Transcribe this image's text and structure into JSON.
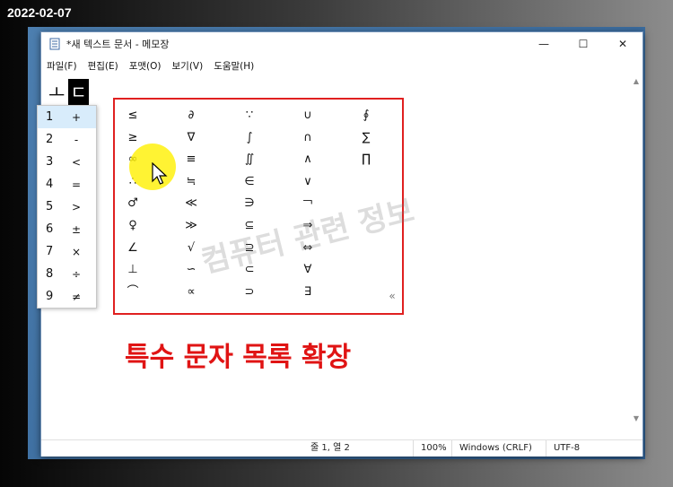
{
  "date_stamp": "2022-02-07",
  "window": {
    "title": "*새 텍스트 문서 - 메모장",
    "controls": {
      "minimize": "—",
      "maximize": "☐",
      "close": "✕"
    }
  },
  "menu": [
    "파일(F)",
    "편집(E)",
    "포맷(O)",
    "보기(V)",
    "도움말(H)"
  ],
  "editor": {
    "text": "ㅗ",
    "selected": "ㄷ"
  },
  "candidates": [
    {
      "num": "1",
      "sym": "+"
    },
    {
      "num": "2",
      "sym": "-"
    },
    {
      "num": "3",
      "sym": "<"
    },
    {
      "num": "4",
      "sym": "="
    },
    {
      "num": "5",
      "sym": ">"
    },
    {
      "num": "6",
      "sym": "±"
    },
    {
      "num": "7",
      "sym": "×"
    },
    {
      "num": "8",
      "sym": "÷"
    },
    {
      "num": "9",
      "sym": "≠"
    }
  ],
  "expanded_columns": [
    [
      "≤",
      "≥",
      "∞",
      "∴",
      "♂",
      "♀",
      "∠",
      "⊥",
      "⌒"
    ],
    [
      "∂",
      "∇",
      "≡",
      "≒",
      "≪",
      "≫",
      "√",
      "∽",
      "∝"
    ],
    [
      "∵",
      "∫",
      "∬",
      "∈",
      "∋",
      "⊆",
      "⊇",
      "⊂",
      "⊃"
    ],
    [
      "∪",
      "∩",
      "∧",
      "∨",
      "￢",
      "⇒",
      "⇔",
      "∀",
      "∃"
    ],
    [
      "∮",
      "∑",
      "∏",
      "",
      "",
      "",
      "",
      "",
      ""
    ]
  ],
  "collapse_glyph": "«",
  "watermark": "컴퓨터 관련 정보",
  "annotation": "특수 문자 목록 확장",
  "scrollbar": {
    "up": "▲",
    "down": "▼"
  },
  "status": {
    "position": "줄 1, 열 2",
    "zoom": "100%",
    "line_ending": "Windows (CRLF)",
    "encoding": "UTF-8"
  },
  "colors": {
    "annotation": "#e01414",
    "highlight_box": "#e02020",
    "cursor_highlight": "#fff000"
  }
}
